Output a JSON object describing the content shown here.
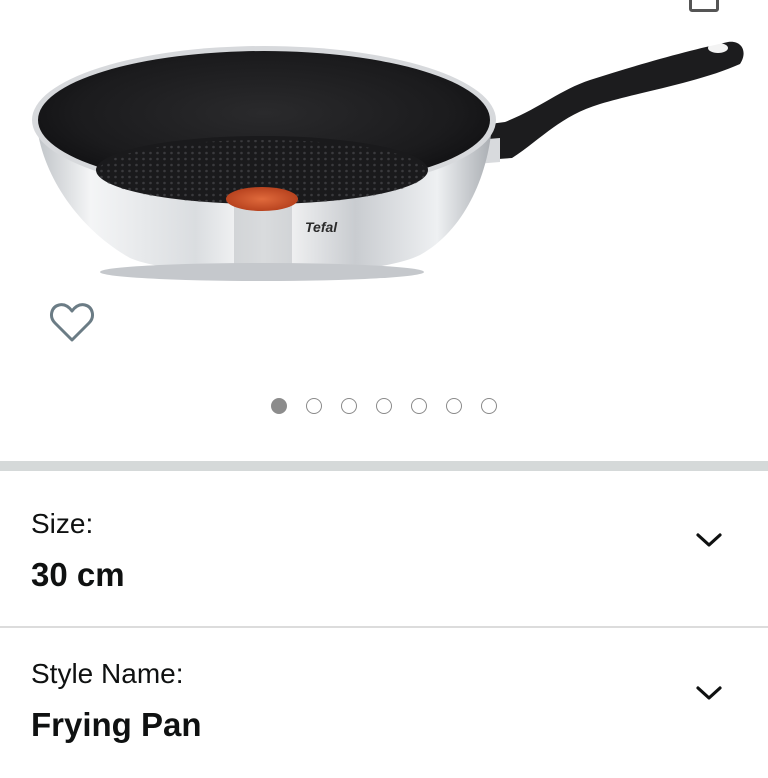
{
  "product": {
    "brand_logo": "Tefal",
    "image_count": 7,
    "active_image_index": 0,
    "colors": {
      "divider": "#d5d9d9",
      "dot_active": "#8c8c8c",
      "text": "#0f1111"
    }
  },
  "icons": {
    "wishlist": "heart-outline-icon",
    "dropdown": "chevron-down-icon"
  },
  "variations": {
    "size": {
      "label": "Size:",
      "value": "30 cm"
    },
    "style": {
      "label": "Style Name:",
      "value": "Frying Pan"
    }
  }
}
